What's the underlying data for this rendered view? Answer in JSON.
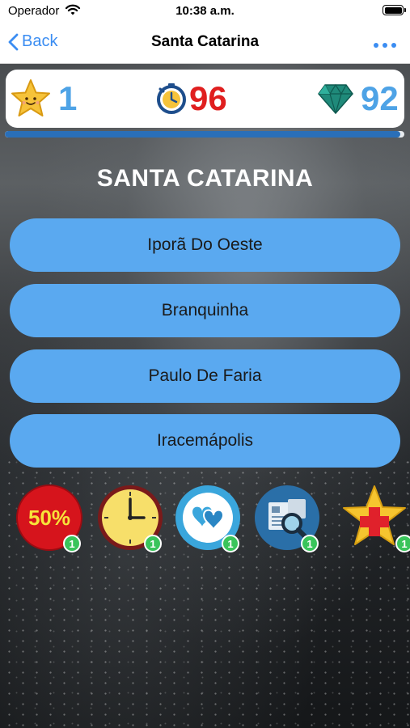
{
  "status_bar": {
    "carrier": "Operador",
    "time": "10:38 a.m."
  },
  "nav": {
    "back_label": "Back",
    "title": "Santa Catarina"
  },
  "scores": {
    "stars": "1",
    "timer": "96",
    "gems": "92"
  },
  "progress": {
    "fraction": 0.99
  },
  "question": {
    "text": "SANTA CATARINA"
  },
  "answers": [
    {
      "label": "Iporã Do Oeste"
    },
    {
      "label": "Branquinha"
    },
    {
      "label": "Paulo De Faria"
    },
    {
      "label": "Iracemápolis"
    }
  ],
  "powerups": [
    {
      "name": "fifty-fifty",
      "label": "50%",
      "count": "1"
    },
    {
      "name": "clock",
      "count": "1"
    },
    {
      "name": "hearts",
      "count": "1"
    },
    {
      "name": "search",
      "count": "1"
    },
    {
      "name": "star-plus",
      "count": "1"
    }
  ],
  "colors": {
    "accent": "#3b8df2",
    "answer_bg": "#5aa9f0",
    "score_blue": "#4ea3e6",
    "score_red": "#e01f1f",
    "badge_green": "#3ac45b"
  }
}
